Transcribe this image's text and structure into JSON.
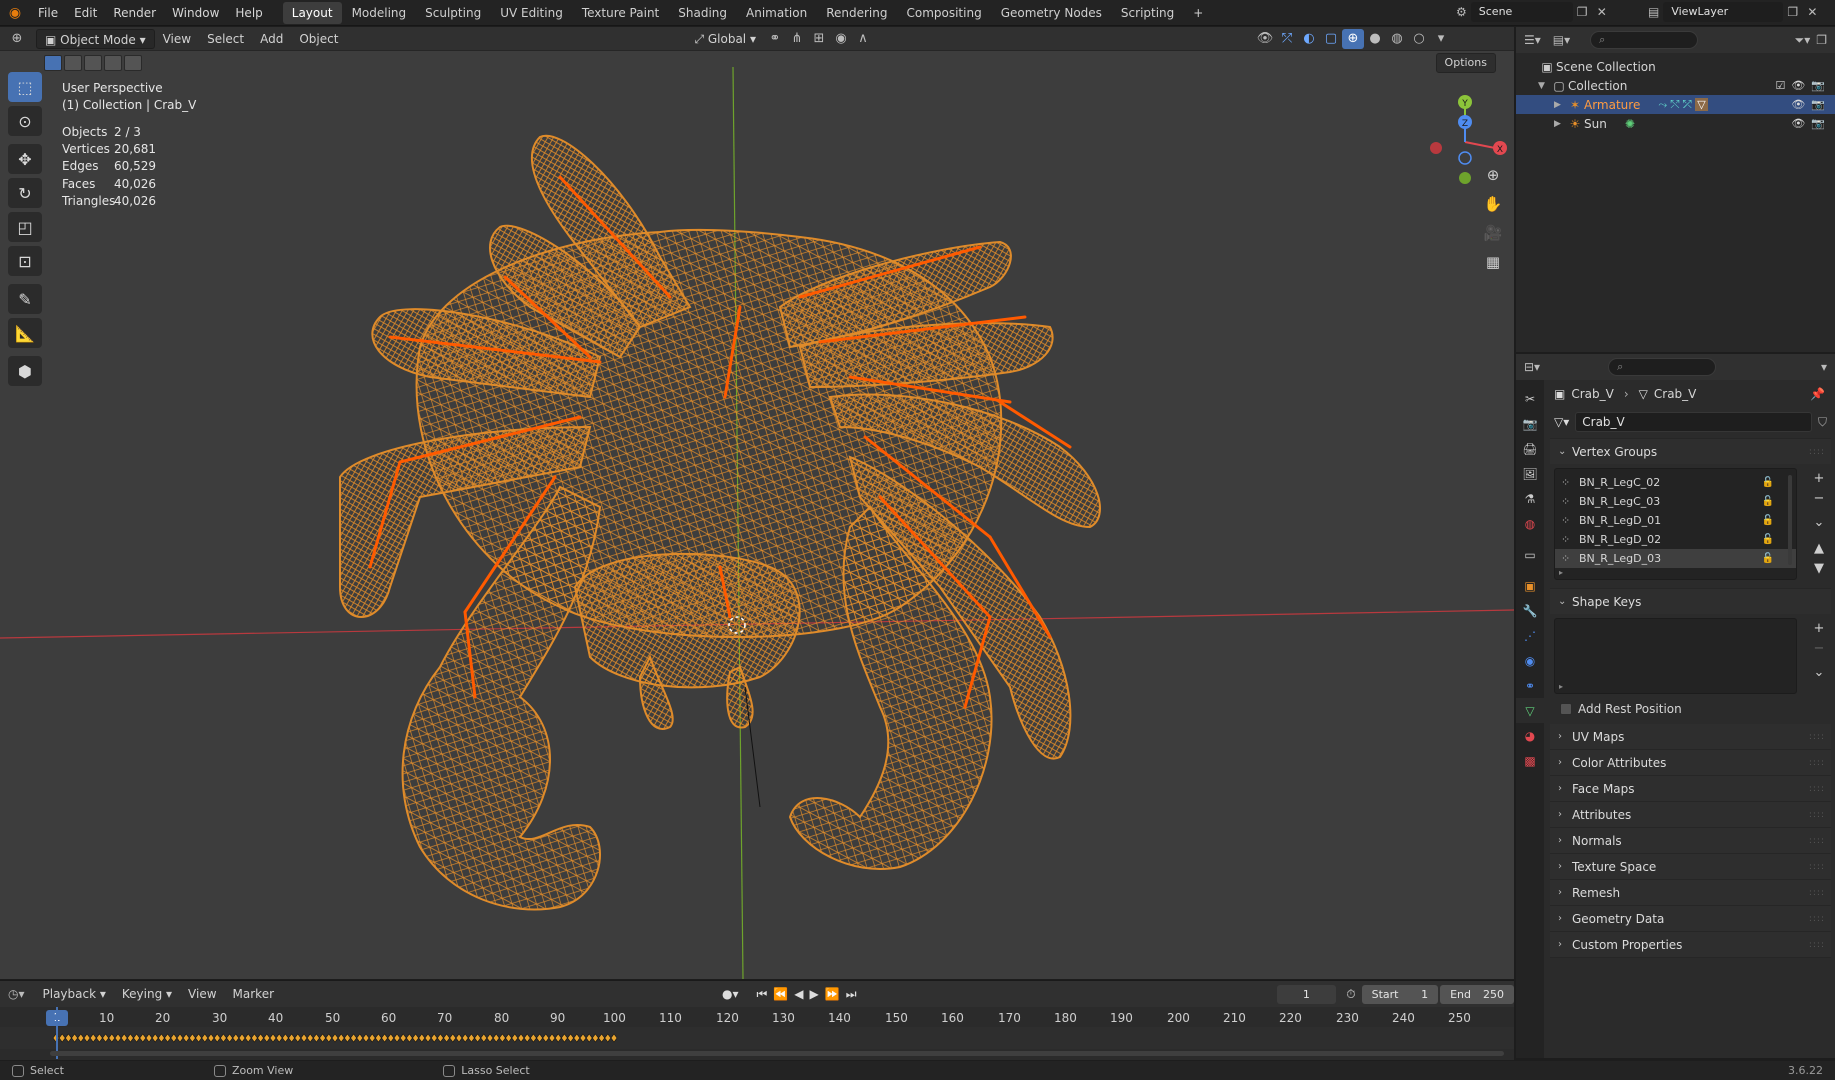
{
  "topbar": {
    "menus": [
      "File",
      "Edit",
      "Render",
      "Window",
      "Help"
    ],
    "workspaces": [
      "Layout",
      "Modeling",
      "Sculpting",
      "UV Editing",
      "Texture Paint",
      "Shading",
      "Animation",
      "Rendering",
      "Compositing",
      "Geometry Nodes",
      "Scripting"
    ],
    "active_workspace": "Layout",
    "add_workspace": "+",
    "scene": "Scene",
    "view_layer": "ViewLayer"
  },
  "viewport": {
    "mode": "Object Mode",
    "menus": [
      "View",
      "Select",
      "Add",
      "Object"
    ],
    "transform_orientation": "Global",
    "options": "Options",
    "perspective": "User Perspective",
    "collection_info": "(1) Collection | Crab_V",
    "stats": [
      {
        "label": "Objects",
        "value": "2 / 3"
      },
      {
        "label": "Vertices",
        "value": "20,681"
      },
      {
        "label": "Edges",
        "value": "60,529"
      },
      {
        "label": "Faces",
        "value": "40,026"
      },
      {
        "label": "Triangles",
        "value": "40,026"
      }
    ],
    "gizmo": {
      "x": "X",
      "y": "Y",
      "z": "Z"
    },
    "mesh_color": "#e8902a",
    "bone_color": "#ff5a00",
    "grid_bg": "#3d3d3d"
  },
  "outliner": {
    "search_placeholder": "",
    "rows": [
      {
        "label": "Scene Collection",
        "icon": "scene-collection-icon",
        "level": 0
      },
      {
        "label": "Collection",
        "icon": "collection-icon",
        "level": 1
      },
      {
        "label": "Armature",
        "icon": "armature-icon",
        "level": 2,
        "selected": true
      },
      {
        "label": "Sun",
        "icon": "sun-icon",
        "level": 2
      }
    ]
  },
  "properties": {
    "breadcrumb_object": "Crab_V",
    "breadcrumb_data": "Crab_V",
    "mesh_name": "Crab_V",
    "vertex_groups_title": "Vertex Groups",
    "vertex_groups": [
      "BN_R_LegC_02",
      "BN_R_LegC_03",
      "BN_R_LegD_01",
      "BN_R_LegD_02",
      "BN_R_LegD_03"
    ],
    "selected_vertex_group": "BN_R_LegD_03",
    "shape_keys_title": "Shape Keys",
    "add_rest_position": "Add Rest Position",
    "collapsed_panels": [
      "UV Maps",
      "Color Attributes",
      "Face Maps",
      "Attributes",
      "Normals",
      "Texture Space",
      "Remesh",
      "Geometry Data",
      "Custom Properties"
    ]
  },
  "timeline": {
    "menus": [
      "Playback",
      "Keying",
      "View",
      "Marker"
    ],
    "current_frame": "1",
    "start_label": "Start",
    "start": "1",
    "end_label": "End",
    "end": "250",
    "ticks": [
      "10",
      "20",
      "30",
      "40",
      "50",
      "60",
      "70",
      "80",
      "90",
      "100",
      "110",
      "120",
      "130",
      "140",
      "150",
      "160",
      "170",
      "180",
      "190",
      "200",
      "210",
      "220",
      "230",
      "240",
      "250"
    ],
    "frame_marker": "1"
  },
  "statusbar": {
    "items": [
      "Select",
      "Zoom View",
      "Lasso Select"
    ],
    "version": "3.6.22"
  }
}
